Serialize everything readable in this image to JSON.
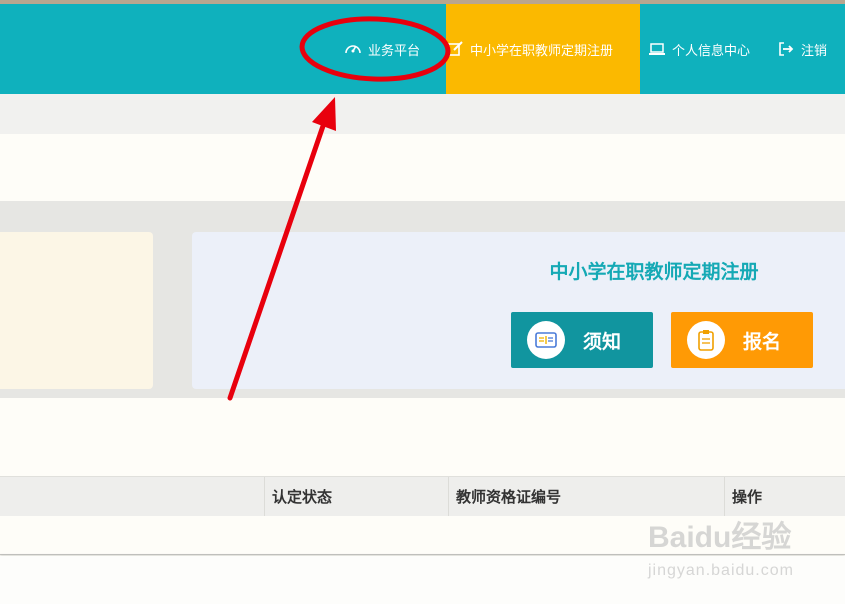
{
  "nav": {
    "items": [
      {
        "label": "业务平台",
        "icon": "dashboard-icon"
      },
      {
        "label": "中小学在职教师定期注册",
        "icon": "edit-icon",
        "active": true
      },
      {
        "label": "个人信息中心",
        "icon": "laptop-icon"
      },
      {
        "label": "注销",
        "icon": "logout-icon"
      }
    ]
  },
  "card": {
    "title": "中小学在职教师定期注册",
    "buttons": [
      {
        "label": "须知",
        "icon": "notice-icon",
        "color": "#11959f"
      },
      {
        "label": "报名",
        "icon": "clipboard-icon",
        "color": "#ff9a05"
      }
    ]
  },
  "table": {
    "headers": [
      "认定状态",
      "教师资格证编号",
      "操作"
    ]
  },
  "watermark": {
    "logo": "Baidu经验",
    "url": "jingyan.baidu.com"
  },
  "colors": {
    "nav_bg": "#0fb1bd",
    "nav_active": "#fbb900",
    "annotation": "#e8000d"
  }
}
